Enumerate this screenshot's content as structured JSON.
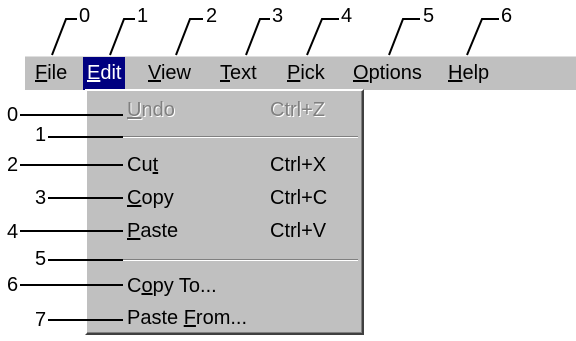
{
  "menubar": {
    "items": [
      {
        "pre": "",
        "mn": "F",
        "post": "ile",
        "callout": "0"
      },
      {
        "pre": "",
        "mn": "E",
        "post": "dit",
        "callout": "1"
      },
      {
        "pre": "",
        "mn": "V",
        "post": "iew",
        "callout": "2"
      },
      {
        "pre": "",
        "mn": "T",
        "post": "ext",
        "callout": "3"
      },
      {
        "pre": "",
        "mn": "P",
        "post": "ick",
        "callout": "4"
      },
      {
        "pre": "",
        "mn": "O",
        "post": "ptions",
        "callout": "5"
      },
      {
        "pre": "",
        "mn": "H",
        "post": "elp",
        "callout": "6"
      }
    ]
  },
  "dropdown": {
    "rows": [
      {
        "callout": "0",
        "pre": "",
        "mn": "U",
        "post": "ndo",
        "shortcut": "Ctrl+Z",
        "disabled": true
      },
      {
        "callout": "1",
        "separator": true
      },
      {
        "callout": "2",
        "pre": "Cu",
        "mn": "t",
        "post": "",
        "shortcut": "Ctrl+X"
      },
      {
        "callout": "3",
        "pre": "",
        "mn": "C",
        "post": "opy",
        "shortcut": "Ctrl+C"
      },
      {
        "callout": "4",
        "pre": "",
        "mn": "P",
        "post": "aste",
        "shortcut": "Ctrl+V"
      },
      {
        "callout": "5",
        "separator": true
      },
      {
        "callout": "6",
        "pre": "C",
        "mn": "o",
        "post": "py To...",
        "shortcut": ""
      },
      {
        "callout": "7",
        "pre": "Paste ",
        "mn": "F",
        "post": "rom...",
        "shortcut": ""
      }
    ]
  }
}
